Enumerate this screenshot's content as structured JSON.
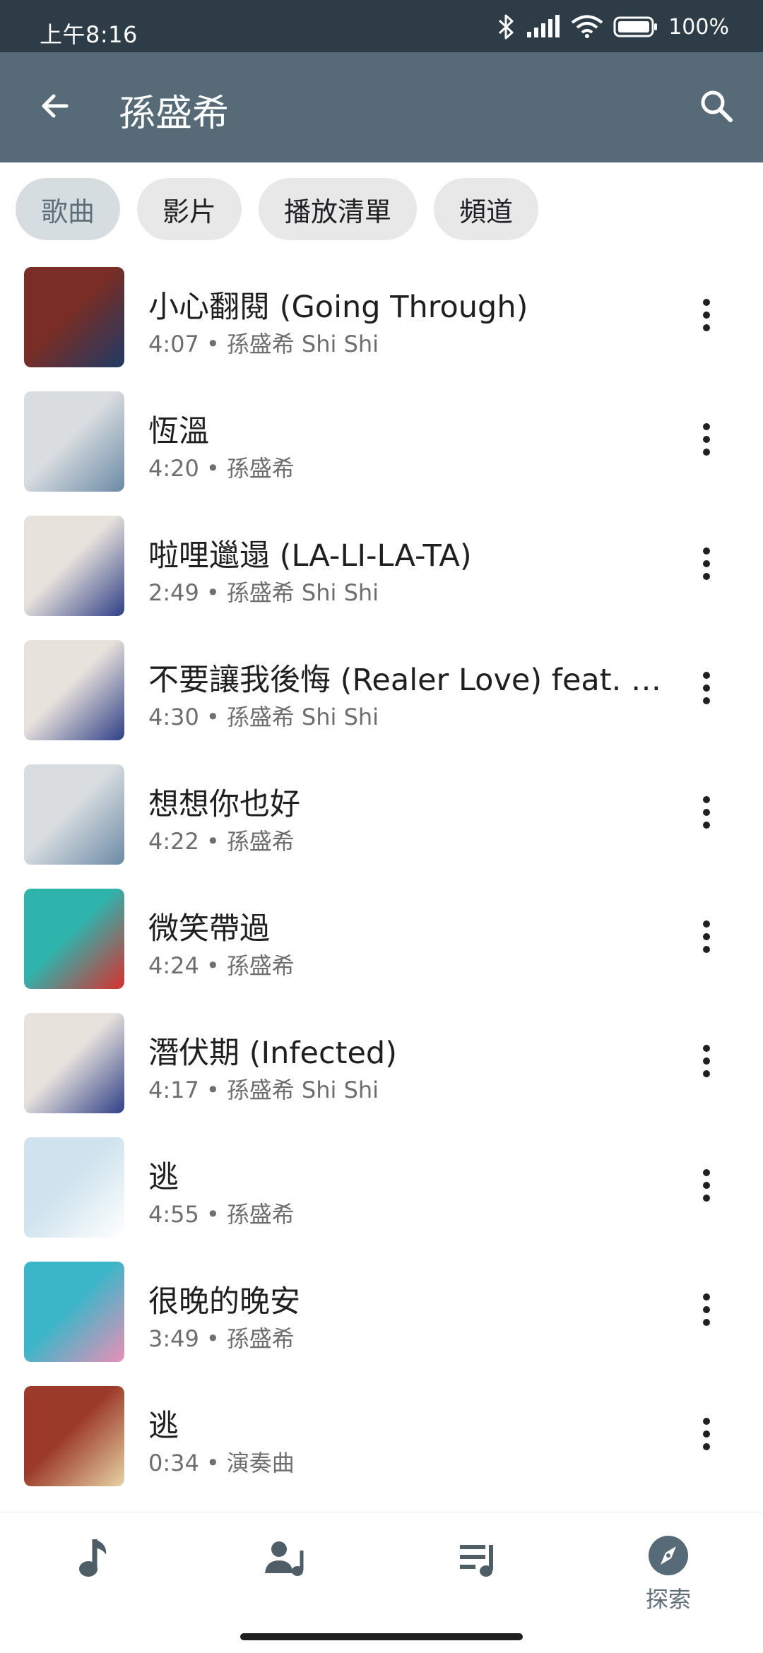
{
  "status": {
    "time": "上午8:16",
    "battery": "100%"
  },
  "appbar": {
    "title": "孫盛希"
  },
  "chips": [
    {
      "label": "歌曲",
      "selected": true
    },
    {
      "label": "影片",
      "selected": false
    },
    {
      "label": "播放清單",
      "selected": false
    },
    {
      "label": "頻道",
      "selected": false
    }
  ],
  "songs": [
    {
      "title": "小心翻閱 (Going Through)",
      "duration": "4:07",
      "artist": "孫盛希 Shi Shi",
      "art_colors": [
        "#7a2d24",
        "#1f3a66"
      ]
    },
    {
      "title": "恆溫",
      "duration": "4:20",
      "artist": "孫盛希",
      "art_colors": [
        "#d9dde0",
        "#6b8aa6"
      ]
    },
    {
      "title": "啦哩邋遢 (LA-LI-LA-TA)",
      "duration": "2:49",
      "artist": "孫盛希 Shi Shi",
      "art_colors": [
        "#e8e2dd",
        "#2e3f86"
      ]
    },
    {
      "title": "不要讓我後悔 (Realer Love) feat. su…",
      "duration": "4:30",
      "artist": "孫盛希 Shi Shi",
      "art_colors": [
        "#e8e2dd",
        "#2e3f86"
      ]
    },
    {
      "title": "想想你也好",
      "duration": "4:22",
      "artist": "孫盛希",
      "art_colors": [
        "#d9dde0",
        "#6b8aa6"
      ]
    },
    {
      "title": "微笑帶過",
      "duration": "4:24",
      "artist": "孫盛希",
      "art_colors": [
        "#2fb3ad",
        "#d8302e"
      ]
    },
    {
      "title": "潛伏期 (Infected)",
      "duration": "4:17",
      "artist": "孫盛希 Shi Shi",
      "art_colors": [
        "#e8e2dd",
        "#2e3f86"
      ]
    },
    {
      "title": "逃",
      "duration": "4:55",
      "artist": "孫盛希",
      "art_colors": [
        "#cfe3ee",
        "#ffffff"
      ]
    },
    {
      "title": "很晚的晚安",
      "duration": "3:49",
      "artist": "孫盛希",
      "art_colors": [
        "#3bb6c9",
        "#e98fb6"
      ]
    },
    {
      "title": "逃",
      "duration": "0:34",
      "artist": "演奏曲",
      "art_colors": [
        "#9c3a2a",
        "#e7d3a4"
      ]
    }
  ],
  "nav": {
    "explore_label": "探索",
    "active_color": "#566b77",
    "icon_color": "#4f5d66"
  },
  "icons": [
    "back-arrow",
    "search",
    "bluetooth",
    "signal",
    "wifi",
    "battery",
    "more-vert",
    "music-note",
    "artist",
    "playlist",
    "compass"
  ]
}
